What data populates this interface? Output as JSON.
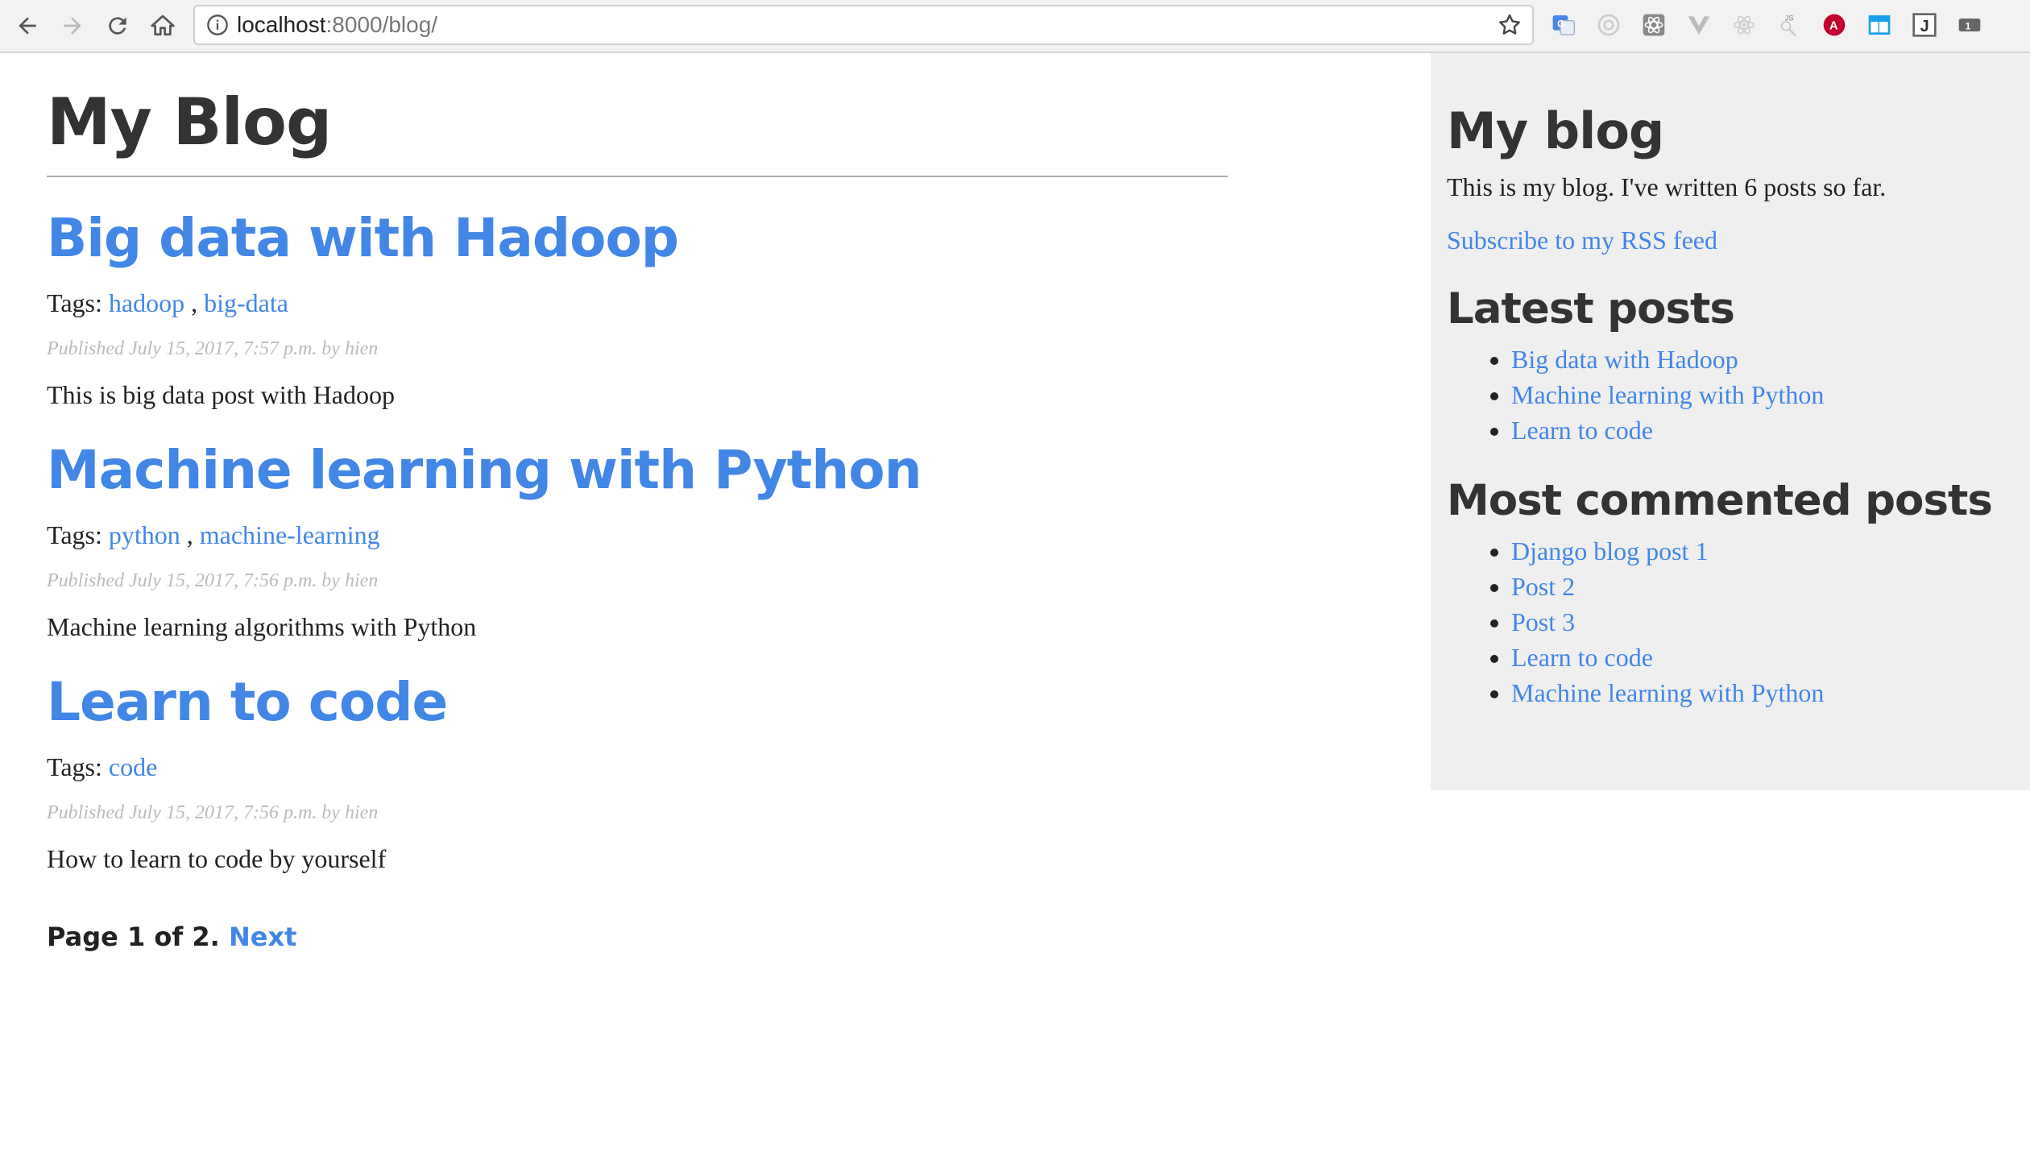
{
  "browser": {
    "url_host": "localhost",
    "url_rest": ":8000/blog/"
  },
  "site_title": "My Blog",
  "posts": [
    {
      "title": "Big data with Hadoop",
      "tags_label": "Tags:",
      "tags": [
        "hadoop",
        "big-data"
      ],
      "published": "Published July 15, 2017, 7:57 p.m. by hien",
      "excerpt": "This is big data post with Hadoop"
    },
    {
      "title": "Machine learning with Python",
      "tags_label": "Tags:",
      "tags": [
        "python",
        "machine-learning"
      ],
      "published": "Published July 15, 2017, 7:56 p.m. by hien",
      "excerpt": "Machine learning algorithms with Python"
    },
    {
      "title": "Learn to code",
      "tags_label": "Tags:",
      "tags": [
        "code"
      ],
      "published": "Published July 15, 2017, 7:56 p.m. by hien",
      "excerpt": "How to learn to code by yourself"
    }
  ],
  "pagination": {
    "text": "Page 1 of 2.",
    "next": "Next"
  },
  "sidebar": {
    "title": "My blog",
    "description": "This is my blog. I've written 6 posts so far.",
    "rss_link": "Subscribe to my RSS feed",
    "latest_heading": "Latest posts",
    "latest": [
      "Big data with Hadoop",
      "Machine learning with Python",
      "Learn to code"
    ],
    "most_commented_heading": "Most commented posts",
    "most_commented": [
      "Django blog post 1",
      "Post 2",
      "Post 3",
      "Learn to code",
      "Machine learning with Python"
    ]
  },
  "colors": {
    "link": "#4286e6",
    "sidebar_bg": "#efefef",
    "meta_text": "#bbbbbb"
  }
}
